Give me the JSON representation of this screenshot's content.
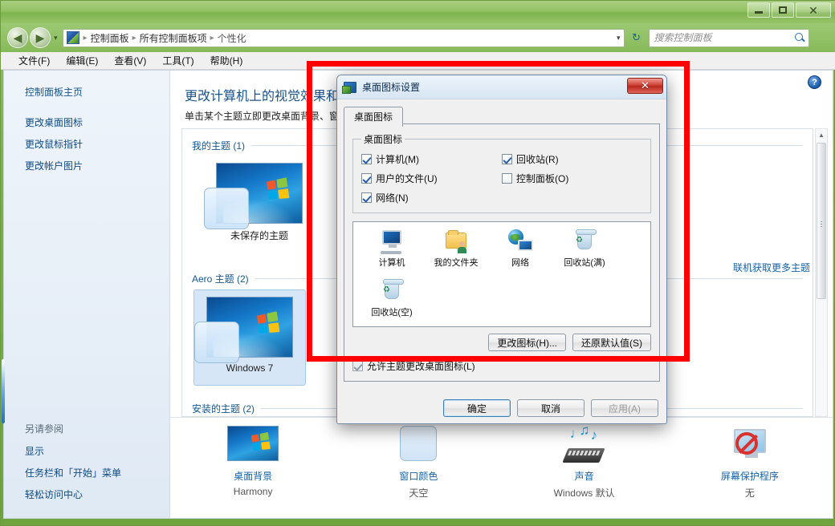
{
  "window": {
    "controls": {
      "minimize": "–",
      "maximize": "□",
      "close": "✕"
    }
  },
  "nav": {
    "back": "◀",
    "forward": "▶",
    "history_caret": "▾",
    "breadcrumb": [
      "控制面板",
      "所有控制面板项",
      "个性化"
    ],
    "breadcrumb_sep": "▸",
    "breadcrumb_caret": "▾",
    "refresh": "↻"
  },
  "search": {
    "placeholder": "搜索控制面板",
    "value": ""
  },
  "menu": {
    "items": [
      "文件(F)",
      "编辑(E)",
      "查看(V)",
      "工具(T)",
      "帮助(H)"
    ]
  },
  "sidebar": {
    "home": "控制面板主页",
    "links": [
      "更改桌面图标",
      "更改鼠标指针",
      "更改帐户图片"
    ],
    "see_also_title": "另请参阅",
    "see_also": [
      "显示",
      "任务栏和「开始」菜单",
      "轻松访问中心"
    ]
  },
  "main": {
    "help_glyph": "?",
    "heading": "更改计算机上的视觉效果和声音",
    "subheading": "单击某个主题立即更改桌面背景、窗口颜色、声音和屏幕保护程序",
    "more_themes_link": "联机获取更多主题",
    "groups": [
      {
        "title": "我的主题 (1)",
        "themes": [
          {
            "name": "未保存的主题",
            "selected": false
          }
        ]
      },
      {
        "title": "Aero 主题 (2)",
        "themes": [
          {
            "name": "Windows 7",
            "selected": true
          }
        ]
      },
      {
        "title": "安装的主题 (2)",
        "themes": []
      }
    ],
    "settings": [
      {
        "label": "桌面背景",
        "value": "Harmony",
        "icon": "wallpaper-icon"
      },
      {
        "label": "窗口颜色",
        "value": "天空",
        "icon": "window-color-icon"
      },
      {
        "label": "声音",
        "value": "Windows 默认",
        "icon": "sound-icon"
      },
      {
        "label": "屏幕保护程序",
        "value": "无",
        "icon": "screensaver-icon"
      }
    ]
  },
  "dialog": {
    "title": "桌面图标设置",
    "close_glyph": "✕",
    "tab": "桌面图标",
    "group_legend": "桌面图标",
    "checkboxes": [
      {
        "label": "计算机(M)",
        "checked": true
      },
      {
        "label": "回收站(R)",
        "checked": true
      },
      {
        "label": "用户的文件(U)",
        "checked": true
      },
      {
        "label": "控制面板(O)",
        "checked": false
      },
      {
        "label": "网络(N)",
        "checked": true
      }
    ],
    "preview_icons": [
      {
        "label": "计算机",
        "icon": "computer-icon"
      },
      {
        "label": "我的文件夹",
        "icon": "user-folder-icon"
      },
      {
        "label": "网络",
        "icon": "network-icon"
      },
      {
        "label": "回收站(满)",
        "icon": "recycle-bin-full-icon"
      },
      {
        "label": "回收站(空)",
        "icon": "recycle-bin-empty-icon"
      }
    ],
    "change_icon_button": "更改图标(H)...",
    "restore_default_button": "还原默认值(S)",
    "allow_theme_checkbox": {
      "label": "允许主题更改桌面图标(L)",
      "checked": true
    },
    "ok_button": "确定",
    "cancel_button": "取消",
    "apply_button": "应用(A)"
  },
  "annotation": {
    "color": "#fe0000"
  }
}
